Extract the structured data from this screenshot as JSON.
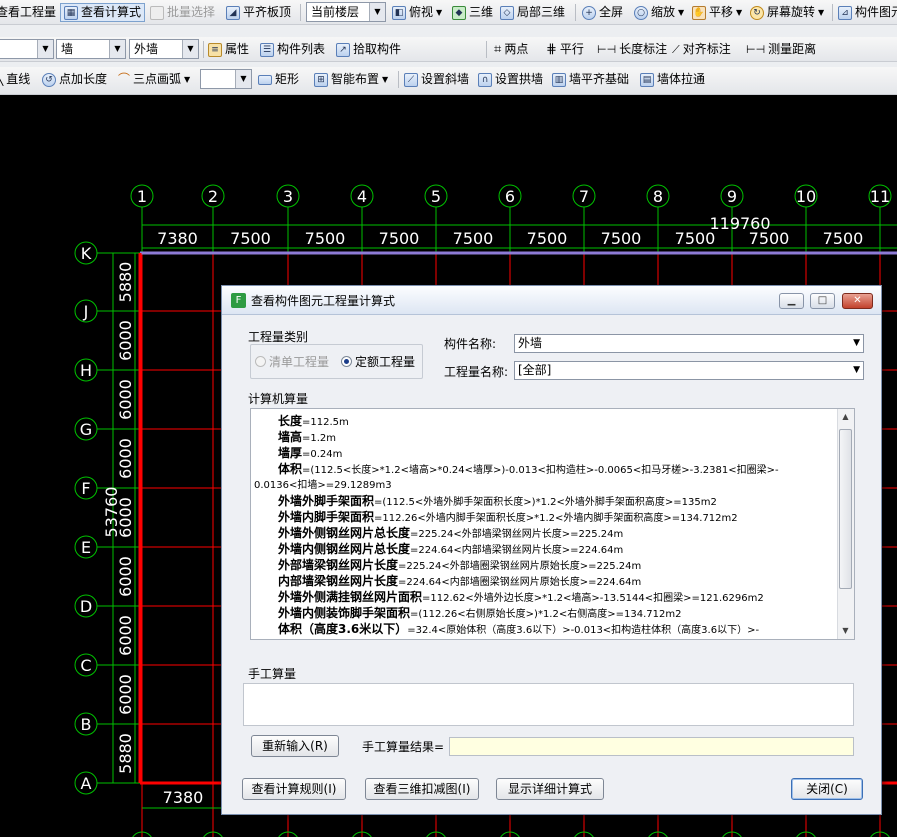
{
  "toolbar1": {
    "view_quantity": "查看工程量",
    "view_formula": "查看计算式",
    "batch_select": "批量选择",
    "align_slab_top": "平齐板顶",
    "floor_combo": "当前楼层",
    "plan_view": "俯视",
    "view_3d": "三维",
    "local_3d": "局部三维",
    "full_view": "全屏",
    "zoom": "缩放",
    "pan": "平移",
    "rotate_screen": "屏幕旋转",
    "component_view": "构件图元"
  },
  "toolbar2": {
    "combo1": "",
    "combo_type": "墙",
    "combo_name": "外墙",
    "properties": "属性",
    "component_list": "构件列表",
    "pick_component": "拾取构件",
    "two_points": "两点",
    "parallel": "平行",
    "length_label": "长度标注",
    "aligned_label": "对齐标注",
    "measure_distance": "测量距离"
  },
  "toolbar3": {
    "line": "直线",
    "point_length": "点加长度",
    "three_point_arc": "三点画弧",
    "combo_blank": "",
    "rectangle": "矩形",
    "smart_layout": "智能布置",
    "set_slope": "设置斜墙",
    "set_arch": "设置拱墙",
    "wall_align_base": "墙平齐基础",
    "wall_stretch": "墙体拉通"
  },
  "cad": {
    "col_axes": [
      "1",
      "2",
      "3",
      "4",
      "5",
      "6",
      "7",
      "8",
      "9",
      "10",
      "11"
    ],
    "col_spans": [
      "7380",
      "7500",
      "7500",
      "7500",
      "7500",
      "7500",
      "7500",
      "7500",
      "7500",
      "7500"
    ],
    "col_total": "119760",
    "row_axes": [
      "K",
      "J",
      "H",
      "G",
      "F",
      "E",
      "D",
      "C",
      "B",
      "A"
    ],
    "row_spans": [
      "5880",
      "6000",
      "6000",
      "6000",
      "6000",
      "6000",
      "6000",
      "6000",
      "5880"
    ],
    "row_total": "53760",
    "bottom_span": "7380",
    "colors": {
      "grid_green": "#00c000",
      "wall_red": "#ff0000",
      "wall_purple": "#8e7bd6"
    }
  },
  "dialog": {
    "title": "查看构件图元工程量计算式",
    "qty_type_label": "工程量类别",
    "radio_bill": "清单工程量",
    "radio_norm": "定额工程量",
    "component_name_label": "构件名称:",
    "component_name_value": "外墙",
    "qty_name_label": "工程量名称:",
    "qty_name_value": "[全部]",
    "computer_calc_label": "计算机算量",
    "calc_lines": [
      {
        "name": "长度",
        "expr": "=112.5m"
      },
      {
        "name": "墙高",
        "expr": "=1.2m"
      },
      {
        "name": "墙厚",
        "expr": "=0.24m"
      },
      {
        "name": "体积",
        "expr": "=(112.5<长度>*1.2<墙高>*0.24<墙厚>)-0.013<扣构造柱>-0.0065<扣马牙槎>-3.2381<扣圈梁>-"
      },
      {
        "name": "",
        "expr": "0.0136<扣墙>=29.1289m3"
      },
      {
        "name": "外墙外脚手架面积",
        "expr": "=(112.5<外墙外脚手架面积长度>)*1.2<外墙外脚手架面积高度>=135m2"
      },
      {
        "name": "外墙内脚手架面积",
        "expr": "=112.26<外墙内脚手架面积长度>*1.2<外墙内脚手架面积高度>=134.712m2"
      },
      {
        "name": "外墙外侧钢丝网片总长度",
        "expr": "=225.24<外部墙梁钢丝网片长度>=225.24m"
      },
      {
        "name": "外墙内侧钢丝网片总长度",
        "expr": "=224.64<内部墙梁钢丝网片长度>=224.64m"
      },
      {
        "name": "外部墙梁钢丝网片长度",
        "expr": "=225.24<外部墙圈梁钢丝网片原始长度>=225.24m"
      },
      {
        "name": "内部墙梁钢丝网片长度",
        "expr": "=224.64<内部墙圈梁钢丝网片原始长度>=224.64m"
      },
      {
        "name": "外墙外侧满挂钢丝网片面积",
        "expr": "=112.62<外墙外边长度>*1.2<墙高>-13.5144<扣圈梁>=121.6296m2"
      },
      {
        "name": "外墙内侧装饰脚手架面积",
        "expr": "=(112.26<右侧原始长度>)*1.2<右侧高度>=134.712m2"
      },
      {
        "name": "体积（高度3.6米以下）",
        "expr": "=32.4<原始体积（高度3.6以下）>-0.013<扣构造柱体积（高度3.6以下）>-"
      }
    ],
    "manual_calc_label": "手工算量",
    "reinput_button": "重新输入(R)",
    "manual_result_label": "手工算量结果=",
    "view_rules_button": "查看计算规则(I)",
    "view_3d_deduct_button": "查看三维扣减图(I)",
    "show_detail_button": "显示详细计算式",
    "close_button": "关闭(C)"
  }
}
